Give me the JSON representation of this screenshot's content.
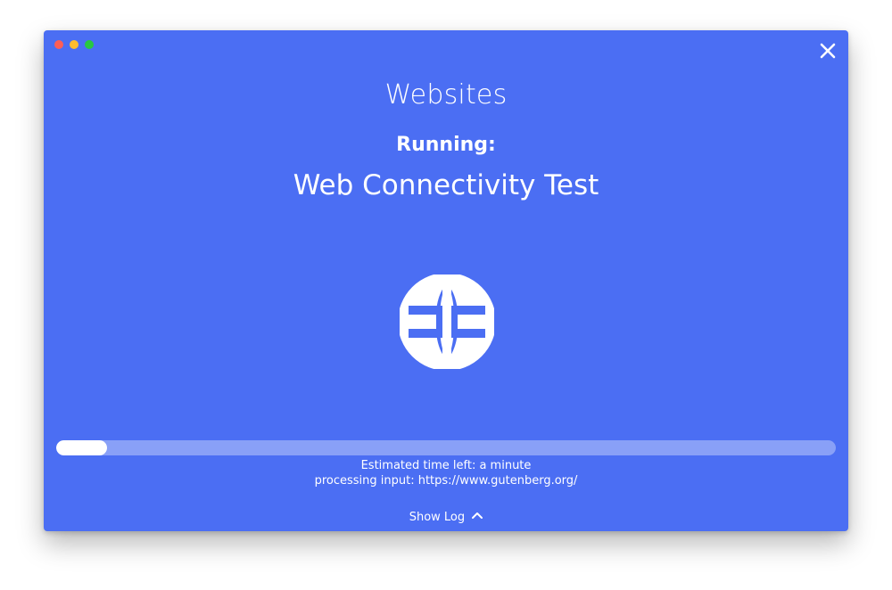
{
  "window": {
    "traffic_lights": [
      {
        "name": "close",
        "color": "#fd5e57"
      },
      {
        "name": "minimize",
        "color": "#febc2e"
      },
      {
        "name": "zoom",
        "color": "#28c840"
      }
    ],
    "background_color": "#4b6ef3",
    "close_icon": "close-icon"
  },
  "header": {
    "title": "Websites",
    "running_label": "Running:",
    "test_name": "Web Connectivity Test"
  },
  "illustration": {
    "icon": "globe-icon"
  },
  "progress": {
    "fraction": 0.065,
    "eta_text": "Estimated time left: a minute",
    "processing_text": "processing input: https://www.gutenberg.org/"
  },
  "footer": {
    "show_log_label": "Show Log",
    "show_log_icon": "chevron-up-icon"
  }
}
